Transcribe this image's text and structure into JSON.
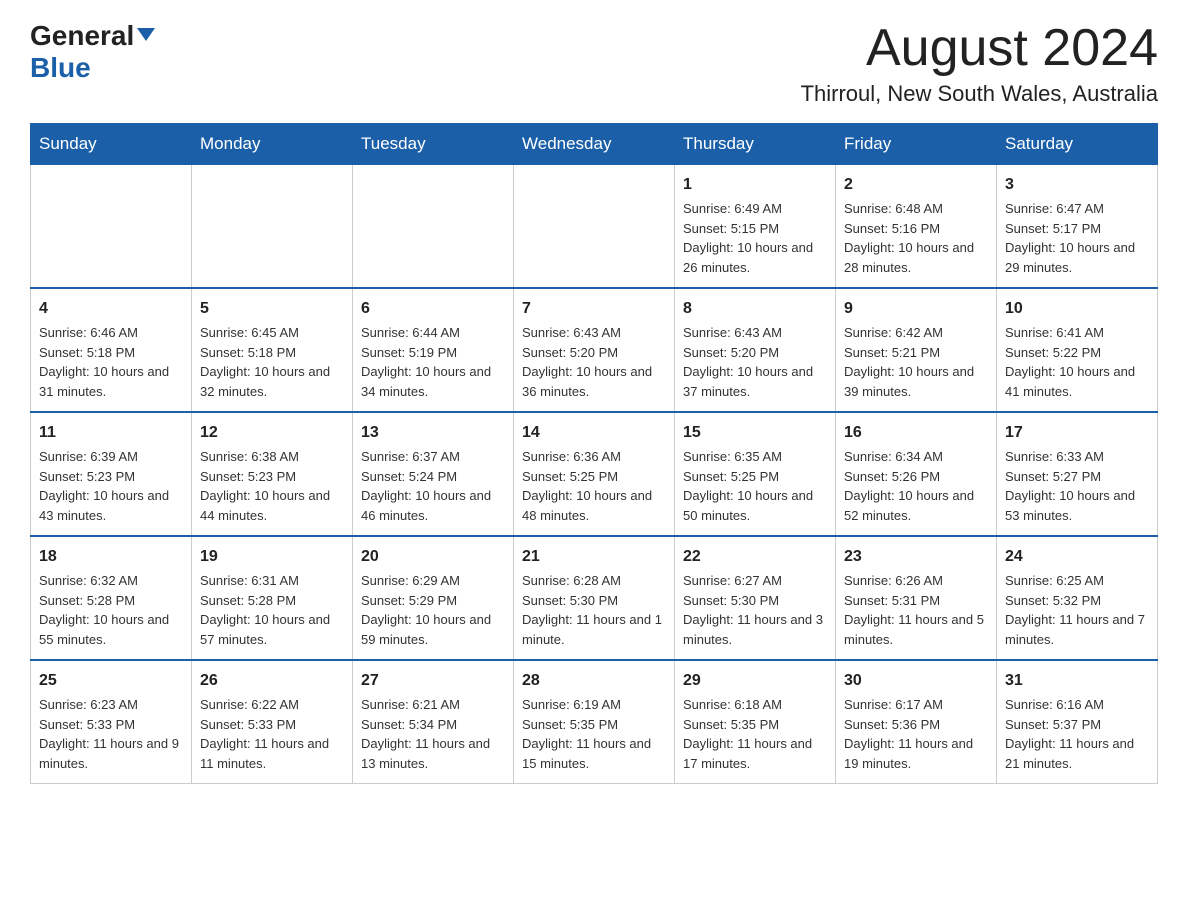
{
  "logo": {
    "general": "General",
    "blue": "Blue"
  },
  "header": {
    "month": "August 2024",
    "location": "Thirroul, New South Wales, Australia"
  },
  "weekdays": [
    "Sunday",
    "Monday",
    "Tuesday",
    "Wednesday",
    "Thursday",
    "Friday",
    "Saturday"
  ],
  "weeks": [
    [
      {
        "day": "",
        "info": ""
      },
      {
        "day": "",
        "info": ""
      },
      {
        "day": "",
        "info": ""
      },
      {
        "day": "",
        "info": ""
      },
      {
        "day": "1",
        "info": "Sunrise: 6:49 AM\nSunset: 5:15 PM\nDaylight: 10 hours and 26 minutes."
      },
      {
        "day": "2",
        "info": "Sunrise: 6:48 AM\nSunset: 5:16 PM\nDaylight: 10 hours and 28 minutes."
      },
      {
        "day": "3",
        "info": "Sunrise: 6:47 AM\nSunset: 5:17 PM\nDaylight: 10 hours and 29 minutes."
      }
    ],
    [
      {
        "day": "4",
        "info": "Sunrise: 6:46 AM\nSunset: 5:18 PM\nDaylight: 10 hours and 31 minutes."
      },
      {
        "day": "5",
        "info": "Sunrise: 6:45 AM\nSunset: 5:18 PM\nDaylight: 10 hours and 32 minutes."
      },
      {
        "day": "6",
        "info": "Sunrise: 6:44 AM\nSunset: 5:19 PM\nDaylight: 10 hours and 34 minutes."
      },
      {
        "day": "7",
        "info": "Sunrise: 6:43 AM\nSunset: 5:20 PM\nDaylight: 10 hours and 36 minutes."
      },
      {
        "day": "8",
        "info": "Sunrise: 6:43 AM\nSunset: 5:20 PM\nDaylight: 10 hours and 37 minutes."
      },
      {
        "day": "9",
        "info": "Sunrise: 6:42 AM\nSunset: 5:21 PM\nDaylight: 10 hours and 39 minutes."
      },
      {
        "day": "10",
        "info": "Sunrise: 6:41 AM\nSunset: 5:22 PM\nDaylight: 10 hours and 41 minutes."
      }
    ],
    [
      {
        "day": "11",
        "info": "Sunrise: 6:39 AM\nSunset: 5:23 PM\nDaylight: 10 hours and 43 minutes."
      },
      {
        "day": "12",
        "info": "Sunrise: 6:38 AM\nSunset: 5:23 PM\nDaylight: 10 hours and 44 minutes."
      },
      {
        "day": "13",
        "info": "Sunrise: 6:37 AM\nSunset: 5:24 PM\nDaylight: 10 hours and 46 minutes."
      },
      {
        "day": "14",
        "info": "Sunrise: 6:36 AM\nSunset: 5:25 PM\nDaylight: 10 hours and 48 minutes."
      },
      {
        "day": "15",
        "info": "Sunrise: 6:35 AM\nSunset: 5:25 PM\nDaylight: 10 hours and 50 minutes."
      },
      {
        "day": "16",
        "info": "Sunrise: 6:34 AM\nSunset: 5:26 PM\nDaylight: 10 hours and 52 minutes."
      },
      {
        "day": "17",
        "info": "Sunrise: 6:33 AM\nSunset: 5:27 PM\nDaylight: 10 hours and 53 minutes."
      }
    ],
    [
      {
        "day": "18",
        "info": "Sunrise: 6:32 AM\nSunset: 5:28 PM\nDaylight: 10 hours and 55 minutes."
      },
      {
        "day": "19",
        "info": "Sunrise: 6:31 AM\nSunset: 5:28 PM\nDaylight: 10 hours and 57 minutes."
      },
      {
        "day": "20",
        "info": "Sunrise: 6:29 AM\nSunset: 5:29 PM\nDaylight: 10 hours and 59 minutes."
      },
      {
        "day": "21",
        "info": "Sunrise: 6:28 AM\nSunset: 5:30 PM\nDaylight: 11 hours and 1 minute."
      },
      {
        "day": "22",
        "info": "Sunrise: 6:27 AM\nSunset: 5:30 PM\nDaylight: 11 hours and 3 minutes."
      },
      {
        "day": "23",
        "info": "Sunrise: 6:26 AM\nSunset: 5:31 PM\nDaylight: 11 hours and 5 minutes."
      },
      {
        "day": "24",
        "info": "Sunrise: 6:25 AM\nSunset: 5:32 PM\nDaylight: 11 hours and 7 minutes."
      }
    ],
    [
      {
        "day": "25",
        "info": "Sunrise: 6:23 AM\nSunset: 5:33 PM\nDaylight: 11 hours and 9 minutes."
      },
      {
        "day": "26",
        "info": "Sunrise: 6:22 AM\nSunset: 5:33 PM\nDaylight: 11 hours and 11 minutes."
      },
      {
        "day": "27",
        "info": "Sunrise: 6:21 AM\nSunset: 5:34 PM\nDaylight: 11 hours and 13 minutes."
      },
      {
        "day": "28",
        "info": "Sunrise: 6:19 AM\nSunset: 5:35 PM\nDaylight: 11 hours and 15 minutes."
      },
      {
        "day": "29",
        "info": "Sunrise: 6:18 AM\nSunset: 5:35 PM\nDaylight: 11 hours and 17 minutes."
      },
      {
        "day": "30",
        "info": "Sunrise: 6:17 AM\nSunset: 5:36 PM\nDaylight: 11 hours and 19 minutes."
      },
      {
        "day": "31",
        "info": "Sunrise: 6:16 AM\nSunset: 5:37 PM\nDaylight: 11 hours and 21 minutes."
      }
    ]
  ]
}
